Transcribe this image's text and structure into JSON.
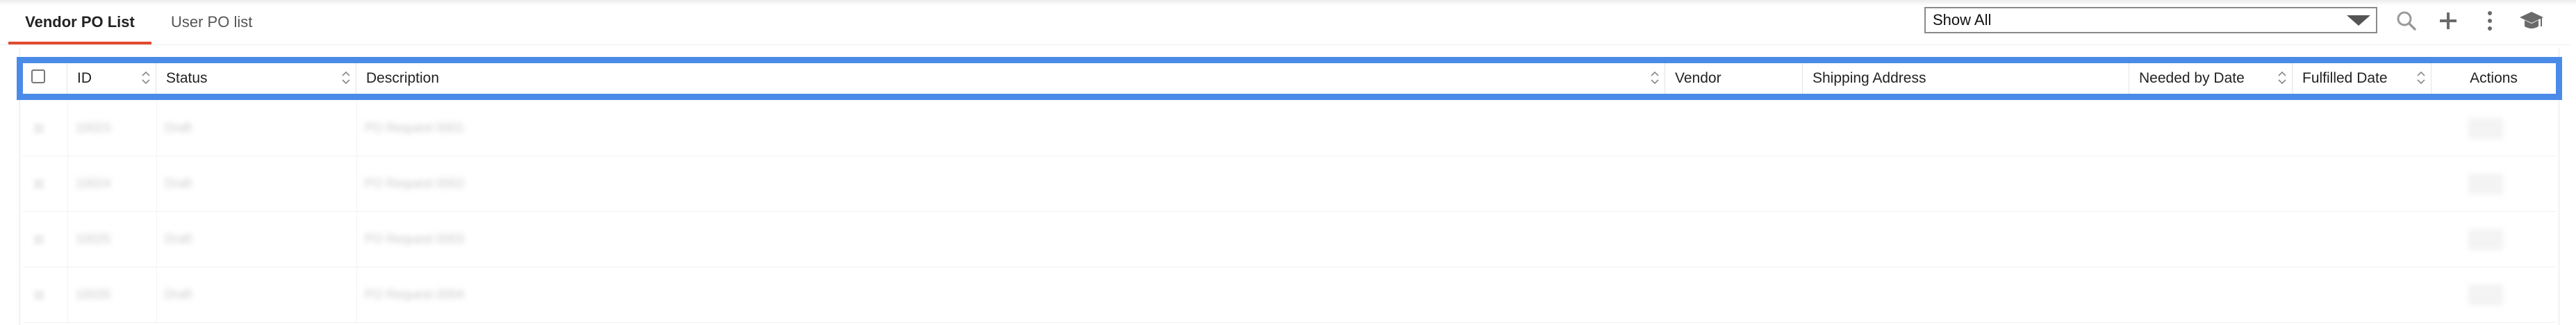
{
  "tabs": [
    {
      "label": "Vendor PO List",
      "active": true
    },
    {
      "label": "User PO list",
      "active": false
    }
  ],
  "filter": {
    "selected": "Show All"
  },
  "toolbar": {
    "icons": [
      "search-icon",
      "plus-icon",
      "more-vertical-icon",
      "graduation-cap-icon"
    ]
  },
  "table": {
    "columns": [
      {
        "label": "",
        "type": "checkbox"
      },
      {
        "label": "ID",
        "sortable": true
      },
      {
        "label": "Status",
        "sortable": true
      },
      {
        "label": "Description",
        "sortable": true
      },
      {
        "label": "Vendor",
        "sortable": false
      },
      {
        "label": "Shipping Address",
        "sortable": false
      },
      {
        "label": "Needed by Date",
        "sortable": true
      },
      {
        "label": "Fulfilled Date",
        "sortable": true
      },
      {
        "label": "Actions",
        "sortable": false
      }
    ],
    "rows": [
      {
        "id": "10023",
        "status": "Draft",
        "description": "PO Request 0001"
      },
      {
        "id": "10024",
        "status": "Draft",
        "description": "PO Request 0002"
      },
      {
        "id": "10025",
        "status": "Draft",
        "description": "PO Request 0003"
      },
      {
        "id": "10026",
        "status": "Draft",
        "description": "PO Request 0004"
      }
    ]
  },
  "colors": {
    "accent_tab": "#e04a2f",
    "header_highlight": "#4a8be8"
  }
}
